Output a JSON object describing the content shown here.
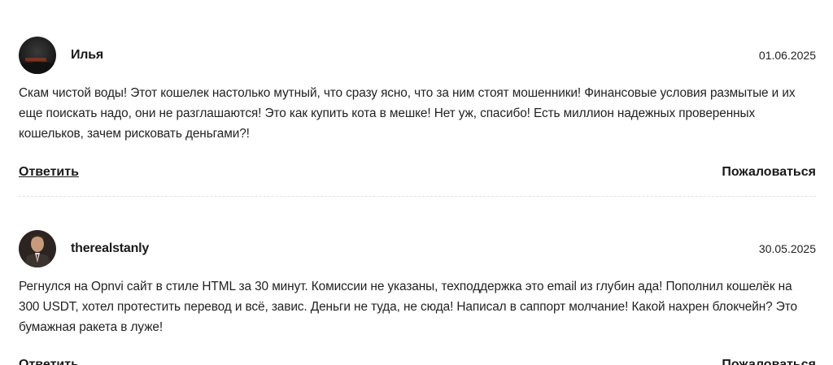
{
  "comments": [
    {
      "author": "Илья",
      "date": "01.06.2025",
      "avatar_icon": "user-avatar-dark-landscape",
      "text": "Скам чистой воды! Этот кошелек настолько мутный, что сразу ясно, что за ним стоят мошенники! Финансовые условия размытые и их еще поискать надо, они не разглашаются! Это как купить кота в мешке! Нет уж, спасибо! Есть миллион надежных проверенных кошельков, зачем рисковать деньгами?!",
      "reply_label": "Ответить",
      "report_label": "Пожаловаться"
    },
    {
      "author": "therealstanly",
      "date": "30.05.2025",
      "avatar_icon": "user-avatar-man-in-suit",
      "text": "Регнулся на Opnvi сайт в стиле HTML за 30 минут. Комиссии не указаны, техподдержка это email из глубин ада! Пополнил кошелёк на 300 USDT, хотел протестить перевод и всё, завис. Деньги не туда, не сюда! Написал в саппорт молчание! Какой нахрен блокчейн? Это бумажная ракета в луже!",
      "reply_label": "Ответить",
      "report_label": "Пожаловаться"
    }
  ],
  "colors": {
    "text": "#222222",
    "divider": "#e2e2e2",
    "background": "#ffffff"
  }
}
